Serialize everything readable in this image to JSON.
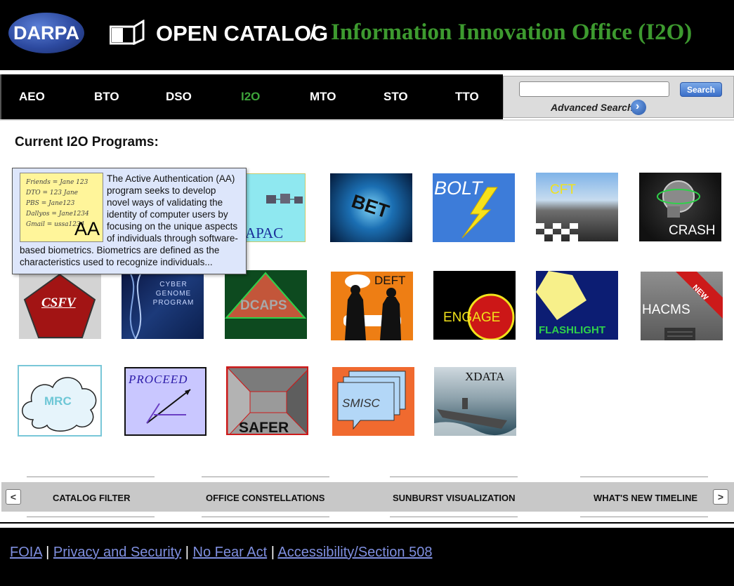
{
  "header": {
    "darpa_logo_text": "DARPA",
    "catalog_title": "OPEN CATALOG",
    "separator": "/",
    "office_title": "Information Innovation Office (I2O)"
  },
  "nav": {
    "items": [
      {
        "label": "AEO",
        "active": false
      },
      {
        "label": "BTO",
        "active": false
      },
      {
        "label": "DSO",
        "active": false
      },
      {
        "label": "I2O",
        "active": true
      },
      {
        "label": "MTO",
        "active": false
      },
      {
        "label": "STO",
        "active": false
      },
      {
        "label": "TTO",
        "active": false
      }
    ],
    "search": {
      "value": "",
      "button_label": "Search",
      "advanced_label": "Advanced Search"
    }
  },
  "main": {
    "section_title": "Current I2O Programs:",
    "tooltip": {
      "thumb_lines": [
        "Friends = Jane 123",
        "DTO = 123 Jane",
        "PBS = Jane123",
        "Dallyos = Jane1234",
        "Gmail = ussa1234"
      ],
      "thumb_label": "AA",
      "description": "The Active Authentication (AA) program seeks to develop novel ways of validating the identity of computer users by focusing on the unique aspects of individuals through software-based biometrics. Biometrics are defined as the characteristics used to recognize individuals..."
    },
    "programs": [
      {
        "id": "apac",
        "label": "APAC"
      },
      {
        "id": "bet",
        "label": "BET"
      },
      {
        "id": "bolt",
        "label": "BOLT"
      },
      {
        "id": "cft",
        "label": "CFT"
      },
      {
        "id": "crash",
        "label": "CRASH"
      },
      {
        "id": "csfv",
        "label": "CSFV"
      },
      {
        "id": "cyber-genome",
        "label": "CYBER GENOME PROGRAM"
      },
      {
        "id": "dcaps",
        "label": "DCAPS"
      },
      {
        "id": "deft",
        "label": "DEFT"
      },
      {
        "id": "engage",
        "label": "ENGAGE"
      },
      {
        "id": "flashlight",
        "label": "FLASHLIGHT"
      },
      {
        "id": "hacms",
        "label": "HACMS",
        "badge": "NEW"
      },
      {
        "id": "mrc",
        "label": "MRC"
      },
      {
        "id": "proceed",
        "label": "PROCEED"
      },
      {
        "id": "safer",
        "label": "SAFER"
      },
      {
        "id": "smisc",
        "label": "SMISC"
      },
      {
        "id": "xdata",
        "label": "XDATA"
      }
    ]
  },
  "bottom_bar": {
    "prev_label": "<",
    "next_label": ">",
    "links": [
      "CATALOG FILTER",
      "OFFICE CONSTELLATIONS",
      "SUNBURST VISUALIZATION",
      "WHAT'S NEW TIMELINE"
    ]
  },
  "footer": {
    "links": [
      "FOIA",
      "Privacy and Security",
      "No Fear Act",
      "Accessibility/Section 508"
    ],
    "separator": "|"
  },
  "colors": {
    "active_nav": "#3da33a",
    "office_title": "#3d9a2f",
    "footer_link": "#7f8fe0",
    "tooltip_bg": "#dde6fb"
  }
}
